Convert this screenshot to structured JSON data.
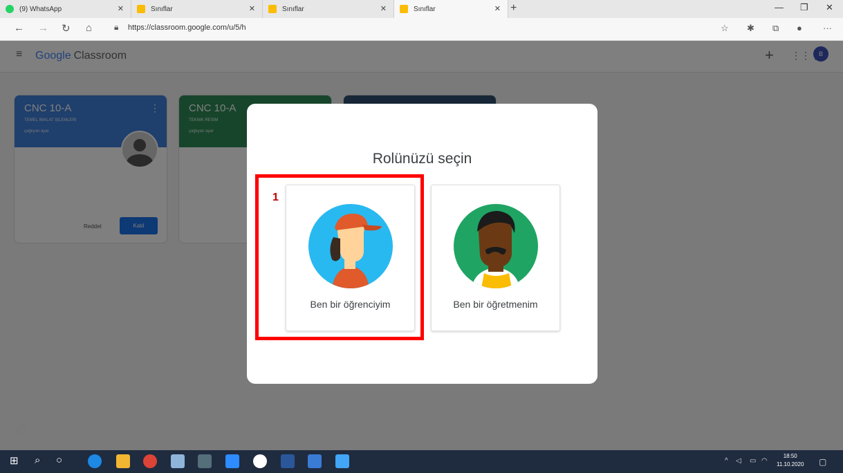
{
  "browser": {
    "tabs": [
      {
        "title": "(9) WhatsApp",
        "icon": "whatsapp-icon",
        "color": "#25d366"
      },
      {
        "title": "Sınıflar",
        "icon": "classroom-icon",
        "color": "#fbbc04"
      },
      {
        "title": "Sınıflar",
        "icon": "classroom-icon",
        "color": "#fbbc04"
      },
      {
        "title": "Sınıflar",
        "icon": "classroom-icon",
        "color": "#fbbc04"
      }
    ],
    "url": "https://classroom.google.com/u/5/h"
  },
  "app": {
    "logo_google": "Google",
    "logo_classroom": "Classroom",
    "avatar_letter": "B"
  },
  "classes": [
    {
      "title": "CNC 10-A",
      "subtitle": "TEMEL İMALAT İŞLEMLERİ",
      "owner": "çağlıyan ayar",
      "color": "#3f7fd8",
      "reject_label": "Reddet",
      "join_label": "Katıl"
    },
    {
      "title": "CNC 10-A",
      "subtitle": "TEKNİK RESİM",
      "owner": "çağlıyan ayar",
      "color": "#2e8b57"
    },
    {
      "title": "",
      "subtitle": "",
      "owner": "",
      "color": "#2f4f6f"
    }
  ],
  "modal": {
    "title": "Rolünüzü seçin",
    "roles": [
      {
        "label": "Ben bir öğrenciyim"
      },
      {
        "label": "Ben bir öğretmenim"
      }
    ],
    "annotation_number": "1",
    "annotation_color": "#ff0000"
  },
  "taskbar": {
    "time": "18:50",
    "date": "11.10.2020"
  }
}
